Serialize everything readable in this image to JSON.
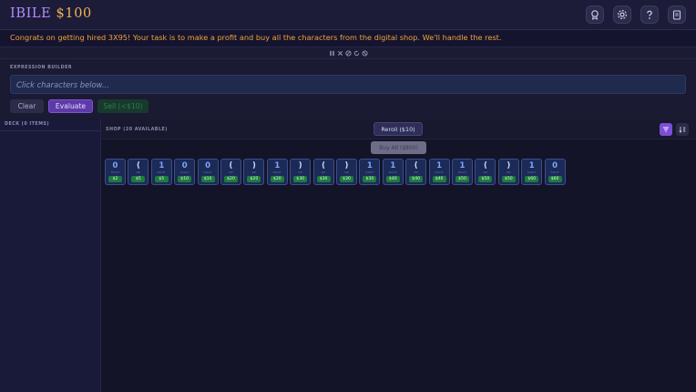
{
  "app": {
    "title_part1": "IBILE",
    "title_part2": "$100"
  },
  "header_icons": [
    "badge-icon",
    "settings-gear-icon",
    "help-icon",
    "clipboard-icon"
  ],
  "banner": {
    "text": "Congrats on getting hired 3X95! Your task is to make a profit and buy all the characters from the digital shop. We'll handle the rest."
  },
  "expression_builder": {
    "label": "EXPRESSION BUILDER",
    "placeholder": "Click characters below...",
    "clear_label": "Clear",
    "evaluate_label": "Evaluate",
    "sell_label": "Sell (<$10)"
  },
  "deck": {
    "label": "DECK (0 ITEMS)"
  },
  "shop": {
    "label": "SHOP (20 AVAILABLE)",
    "reroll_label": "Reroll ($10)",
    "buyall_label": "Buy All ($800)",
    "items": [
      {
        "char": "0",
        "tag": "DIGIT",
        "price": "$2"
      },
      {
        "char": "(",
        "tag": "OP",
        "price": "$5"
      },
      {
        "char": "1",
        "tag": "DIGIT",
        "price": "$5"
      },
      {
        "char": "0",
        "tag": "DIGIT",
        "price": "$10"
      },
      {
        "char": "0",
        "tag": "DIGIT",
        "price": "$10"
      },
      {
        "char": "(",
        "tag": "OP",
        "price": "$20"
      },
      {
        "char": ")",
        "tag": "OP",
        "price": "$20"
      },
      {
        "char": "1",
        "tag": "DIGIT",
        "price": "$20"
      },
      {
        "char": ")",
        "tag": "OP",
        "price": "$30"
      },
      {
        "char": "(",
        "tag": "OP",
        "price": "$30"
      },
      {
        "char": ")",
        "tag": "OP",
        "price": "$30"
      },
      {
        "char": "1",
        "tag": "DIGIT",
        "price": "$30"
      },
      {
        "char": "1",
        "tag": "DIGIT",
        "price": "$40"
      },
      {
        "char": "(",
        "tag": "OP",
        "price": "$40"
      },
      {
        "char": "1",
        "tag": "DIGIT",
        "price": "$40"
      },
      {
        "char": "1",
        "tag": "DIGIT",
        "price": "$50"
      },
      {
        "char": "(",
        "tag": "OP",
        "price": "$50"
      },
      {
        "char": ")",
        "tag": "OP",
        "price": "$50"
      },
      {
        "char": "1",
        "tag": "DIGIT",
        "price": "$60"
      },
      {
        "char": "0",
        "tag": "DIGIT",
        "price": "$60"
      }
    ]
  }
}
